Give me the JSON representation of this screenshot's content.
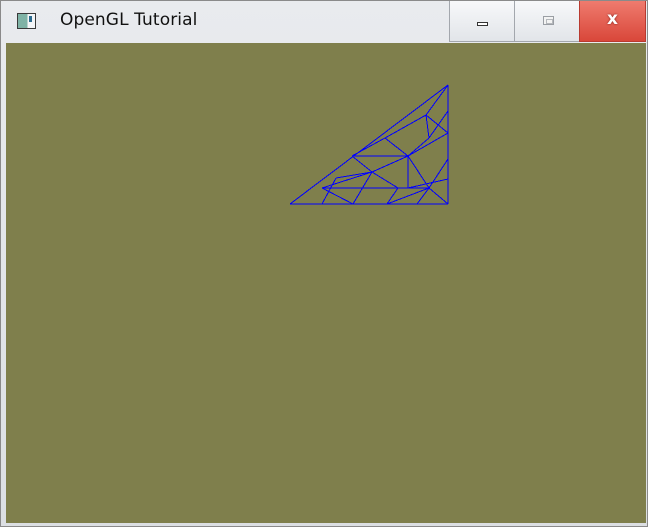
{
  "window": {
    "title": "OpenGL Tutorial",
    "icon": "application-icon",
    "controls": {
      "minimize": "minimize-icon",
      "maximize": "maximize-icon",
      "close": "close-icon",
      "close_glyph": "x"
    }
  },
  "viewport": {
    "clear_color": "#7f7f4c",
    "wireframe_color": "#0000ff"
  }
}
